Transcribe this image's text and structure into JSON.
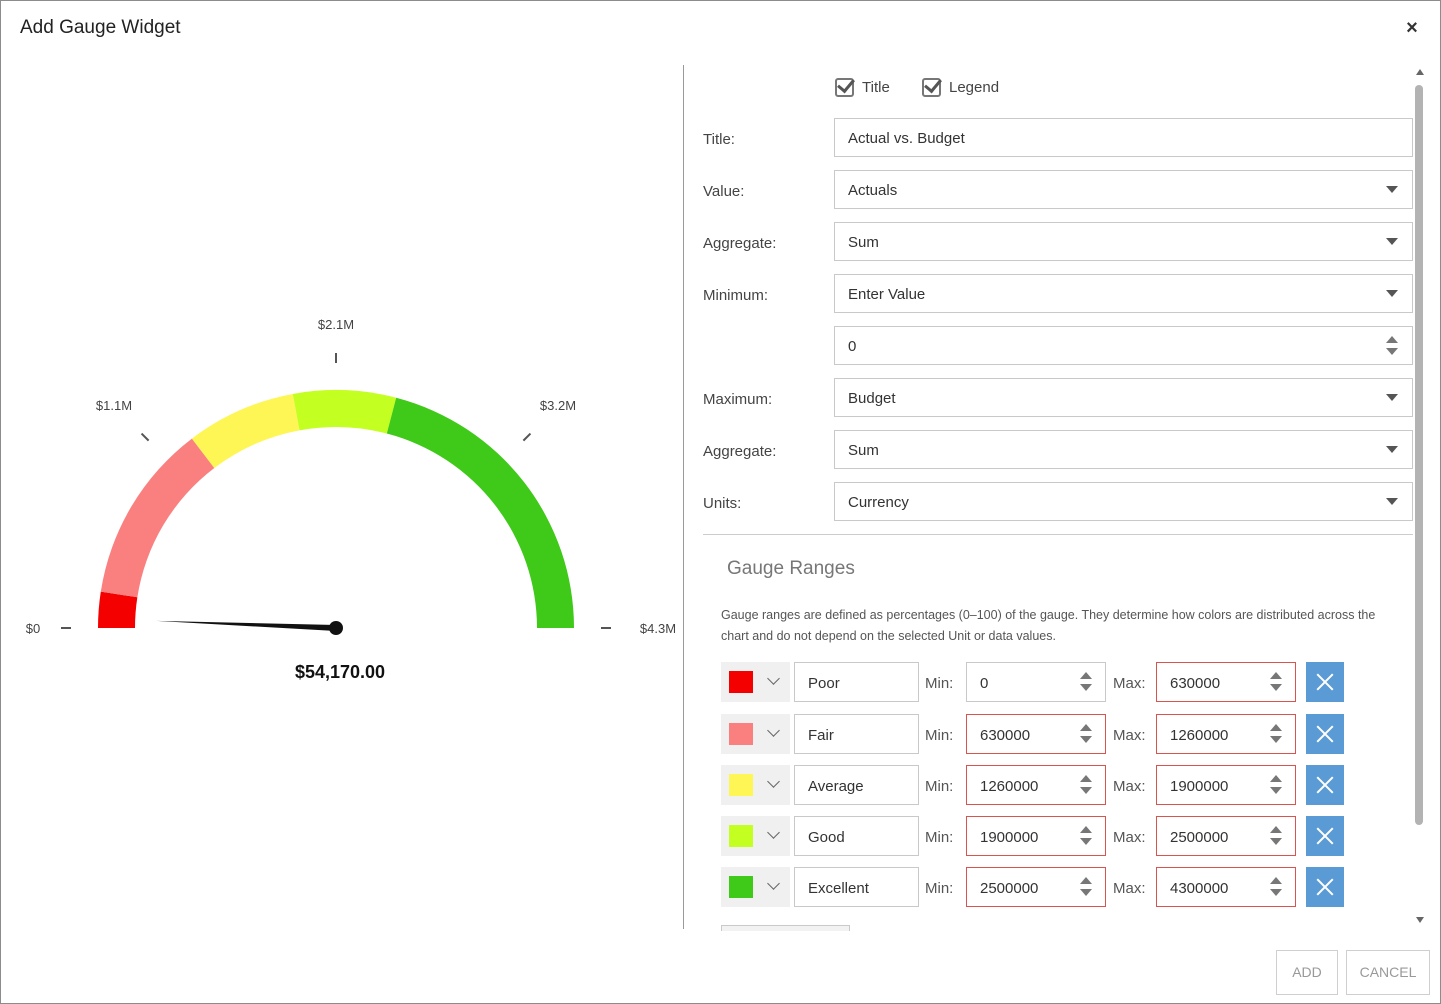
{
  "dialog": {
    "title": "Add Gauge Widget",
    "close_icon": "×"
  },
  "gauge": {
    "value_label": "$54,170.00",
    "value": 54170,
    "min": 0,
    "max": 4300000,
    "ticks": [
      "$0",
      "$1.1M",
      "$2.1M",
      "$3.2M",
      "$4.3M"
    ],
    "tick_values": [
      0,
      1075000,
      2150000,
      3225000,
      4300000
    ],
    "bands": [
      {
        "from": 0,
        "to": 210000,
        "color": "#f50000"
      },
      {
        "from": 210000,
        "to": 1260000,
        "color": "#fa8080"
      },
      {
        "from": 1260000,
        "to": 1900000,
        "color": "#fef655"
      },
      {
        "from": 1900000,
        "to": 2500000,
        "color": "#c4ff22"
      },
      {
        "from": 2500000,
        "to": 4300000,
        "color": "#3fc919"
      }
    ]
  },
  "options": {
    "title_check": {
      "label": "Title",
      "checked": true
    },
    "legend_check": {
      "label": "Legend",
      "checked": true
    }
  },
  "form": {
    "title_label": "Title:",
    "title_value": "Actual vs. Budget",
    "value_label": "Value:",
    "value_value": "Actuals",
    "aggregate1_label": "Aggregate:",
    "aggregate1_value": "Sum",
    "minimum_label": "Minimum:",
    "minimum_value": "Enter Value",
    "minimum_number": "0",
    "maximum_label": "Maximum:",
    "maximum_value": "Budget",
    "aggregate2_label": "Aggregate:",
    "aggregate2_value": "Sum",
    "units_label": "Units:",
    "units_value": "Currency"
  },
  "ranges": {
    "title": "Gauge Ranges",
    "description": "Gauge ranges are defined as percentages (0–100) of the gauge. They determine how colors are distributed across the chart and do not depend on the selected Unit or data values.",
    "min_label": "Min:",
    "max_label": "Max:",
    "rows": [
      {
        "name": "Poor",
        "color": "#f50000",
        "min": "0",
        "max": "630000",
        "min_invalid": false,
        "max_invalid": true
      },
      {
        "name": "Fair",
        "color": "#fa8080",
        "min": "630000",
        "max": "1260000",
        "min_invalid": true,
        "max_invalid": true
      },
      {
        "name": "Average",
        "color": "#fef655",
        "min": "1260000",
        "max": "1900000",
        "min_invalid": true,
        "max_invalid": true
      },
      {
        "name": "Good",
        "color": "#c4ff22",
        "min": "1900000",
        "max": "2500000",
        "min_invalid": true,
        "max_invalid": true
      },
      {
        "name": "Excellent",
        "color": "#3fc919",
        "min": "2500000",
        "max": "4300000",
        "min_invalid": true,
        "max_invalid": true
      }
    ]
  },
  "footer": {
    "add_label": "ADD",
    "cancel_label": "CANCEL"
  }
}
